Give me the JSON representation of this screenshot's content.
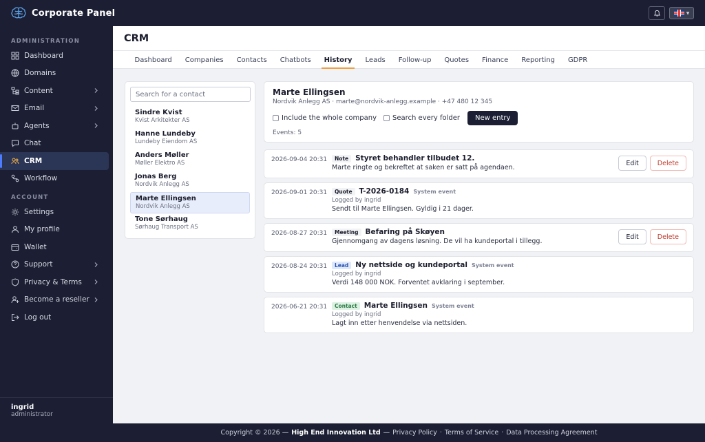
{
  "app": {
    "title": "Corporate Panel"
  },
  "sidebar": {
    "admin_label": "ADMINISTRATION",
    "account_label": "ACCOUNT",
    "admin_items": [
      {
        "label": "Dashboard",
        "icon": "grid-icon"
      },
      {
        "label": "Domains",
        "icon": "globe-icon"
      },
      {
        "label": "Content",
        "icon": "sitemap-icon",
        "chevron": true
      },
      {
        "label": "Email",
        "icon": "mail-icon",
        "chevron": true
      },
      {
        "label": "Agents",
        "icon": "robot-icon",
        "chevron": true
      },
      {
        "label": "Chat",
        "icon": "chat-icon"
      },
      {
        "label": "CRM",
        "icon": "users-icon",
        "active": true
      },
      {
        "label": "Workflow",
        "icon": "workflow-icon"
      }
    ],
    "account_items": [
      {
        "label": "Settings",
        "icon": "gear-icon"
      },
      {
        "label": "My profile",
        "icon": "user-icon"
      },
      {
        "label": "Wallet",
        "icon": "wallet-icon"
      },
      {
        "label": "Support",
        "icon": "help-icon",
        "chevron": true
      },
      {
        "label": "Privacy & Terms",
        "icon": "shield-icon",
        "chevron": true
      },
      {
        "label": "Become a reseller",
        "icon": "user-plus-icon",
        "chevron": true
      },
      {
        "label": "Log out",
        "icon": "logout-icon"
      }
    ],
    "user": {
      "name": "ingrid",
      "role": "administrator"
    }
  },
  "page": {
    "title": "CRM"
  },
  "tabs": [
    "Dashboard",
    "Companies",
    "Contacts",
    "Chatbots",
    "History",
    "Leads",
    "Follow-up",
    "Quotes",
    "Finance",
    "Reporting",
    "GDPR"
  ],
  "active_tab": "History",
  "contacts": {
    "search_placeholder": "Search for a contact",
    "items": [
      {
        "name": "Sindre Kvist",
        "company": "Kvist Arkitekter AS"
      },
      {
        "name": "Hanne Lundeby",
        "company": "Lundeby Eiendom AS"
      },
      {
        "name": "Anders Møller",
        "company": "Møller Elektro AS"
      },
      {
        "name": "Jonas Berg",
        "company": "Nordvik Anlegg AS"
      },
      {
        "name": "Marte Ellingsen",
        "company": "Nordvik Anlegg AS",
        "selected": true
      },
      {
        "name": "Tone Sørhaug",
        "company": "Sørhaug Transport AS"
      }
    ]
  },
  "profile": {
    "name": "Marte Ellingsen",
    "info": "Nordvik Anlegg AS · marte@nordvik-anlegg.example · +47 480 12 345",
    "include_company_label": "Include the whole company",
    "search_folder_label": "Search every folder",
    "new_entry_label": "New entry",
    "events_count": "Events: 5"
  },
  "events": [
    {
      "date": "2026-09-04 20:31",
      "type": "Note",
      "title": "Styret behandler tilbudet 12.",
      "text": "Marte ringte og bekreftet at saken er satt på agendaen.",
      "system": "",
      "logged": "",
      "edit": "Edit",
      "delete": "Delete"
    },
    {
      "date": "2026-09-01 20:31",
      "type": "Quote",
      "title": "T-2026-0184",
      "system": "System event",
      "logged": "Logged by ingrid",
      "text": "Sendt til Marte Ellingsen. Gyldig i 21 dager."
    },
    {
      "date": "2026-08-27 20:31",
      "type": "Meeting",
      "title": "Befaring på Skøyen",
      "text": "Gjennomgang av dagens løsning. De vil ha kundeportal i tillegg.",
      "system": "",
      "logged": "",
      "edit": "Edit",
      "delete": "Delete"
    },
    {
      "date": "2026-08-24 20:31",
      "type": "Lead",
      "title": "Ny nettside og kundeportal",
      "system": "System event",
      "logged": "Logged by ingrid",
      "text": "Verdi 148 000 NOK. Forventet avklaring i september."
    },
    {
      "date": "2026-06-21 20:31",
      "type": "Contact",
      "title": "Marte Ellingsen",
      "system": "System event",
      "logged": "Logged by ingrid",
      "text": "Lagt inn etter henvendelse via nettsiden."
    }
  ],
  "footer": {
    "copyright": "Copyright © 2026 —",
    "company": "High End Innovation Ltd",
    "sep": "—",
    "privacy": "Privacy Policy",
    "terms": "Terms of Service",
    "dpa": "Data Processing Agreement",
    "dot": "·"
  },
  "colors": {
    "sidebar_bg": "#1c1f33",
    "accent": "#4d7cff",
    "tab_underline": "#f0a040",
    "danger": "#c0392b"
  }
}
